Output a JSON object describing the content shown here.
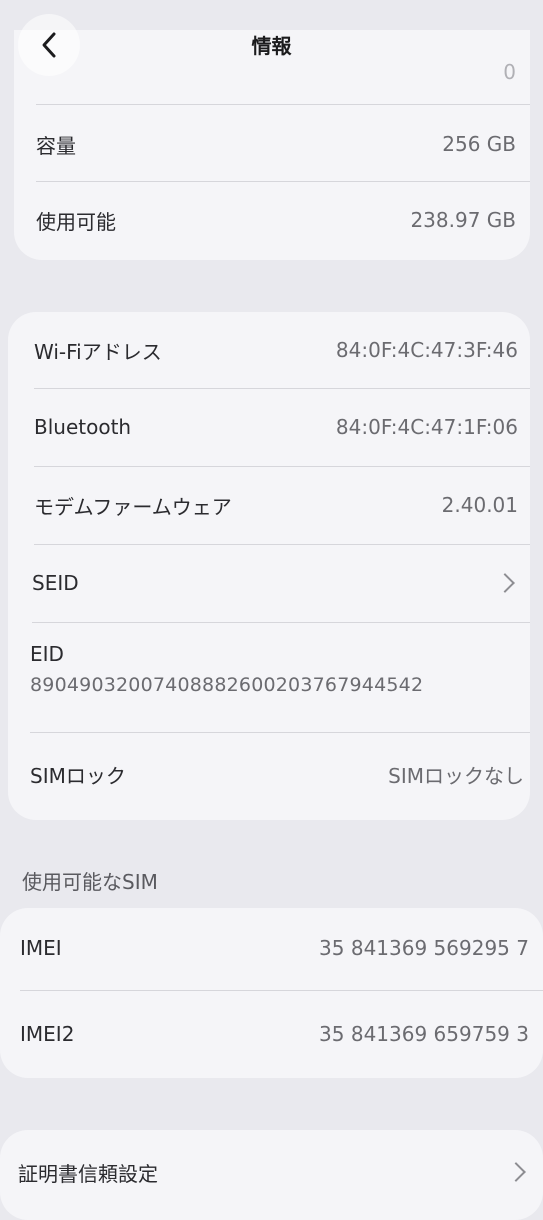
{
  "nav": {
    "title": "情報",
    "back_icon": "chevron-left-icon"
  },
  "storage": {
    "partial_value": "0",
    "rows": [
      {
        "label": "容量",
        "value": "256 GB"
      },
      {
        "label": "使用可能",
        "value": "238.97 GB"
      }
    ]
  },
  "network": {
    "wifi": {
      "label": "Wi-Fiアドレス",
      "value": "84:0F:4C:47:3F:46"
    },
    "bluetooth": {
      "label": "Bluetooth",
      "value": "84:0F:4C:47:1F:06"
    },
    "modem": {
      "label": "モデムファームウェア",
      "value": "2.40.01"
    },
    "seid": {
      "label": "SEID"
    },
    "eid": {
      "label": "EID",
      "value": "89049032007408882600203767944542"
    },
    "simlock": {
      "label": "SIMロック",
      "value": "SIMロックなし"
    }
  },
  "sim_section": {
    "header": "使用可能なSIM",
    "imei": {
      "label": "IMEI",
      "value": "35 841369 569295 7"
    },
    "imei2": {
      "label": "IMEI2",
      "value": "35 841369 659759 3"
    }
  },
  "cert": {
    "label": "証明書信頼設定"
  }
}
